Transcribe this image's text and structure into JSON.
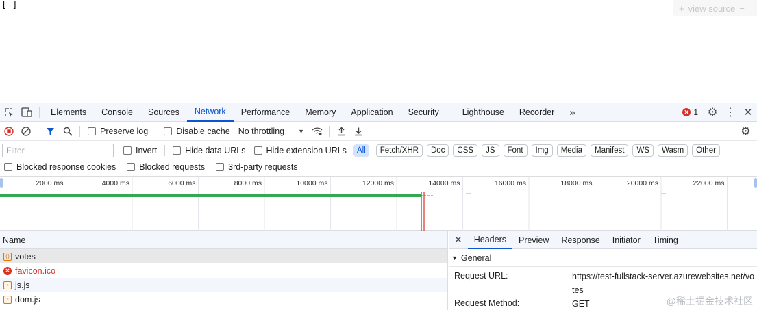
{
  "page": {
    "content": "[ ]",
    "view_source": "view source",
    "view_source_plus": "+",
    "view_source_minus": "−"
  },
  "devtools": {
    "tabs": [
      "Elements",
      "Console",
      "Sources",
      "Network",
      "Performance",
      "Memory",
      "Application",
      "Security",
      "Lighthouse",
      "Recorder"
    ],
    "more_tabs": "»",
    "error_count": "1",
    "toolbar": {
      "preserve_log": "Preserve log",
      "disable_cache": "Disable cache",
      "throttling": "No throttling",
      "throttling_arrow": "▼"
    },
    "filter": {
      "placeholder": "Filter",
      "invert": "Invert",
      "hide_data_urls": "Hide data URLs",
      "hide_extension_urls": "Hide extension URLs",
      "types": [
        "All",
        "Fetch/XHR",
        "Doc",
        "CSS",
        "JS",
        "Font",
        "Img",
        "Media",
        "Manifest",
        "WS",
        "Wasm",
        "Other"
      ]
    },
    "blocking": {
      "blocked_response_cookies": "Blocked response cookies",
      "blocked_requests": "Blocked requests",
      "third_party": "3rd-party requests"
    },
    "timeline_ticks": [
      "2000 ms",
      "4000 ms",
      "6000 ms",
      "8000 ms",
      "10000 ms",
      "12000 ms",
      "14000 ms",
      "16000 ms",
      "18000 ms",
      "20000 ms",
      "22000 ms"
    ],
    "list": {
      "header": "Name",
      "requests": [
        {
          "name": "votes",
          "kind": "fetch"
        },
        {
          "name": "favicon.ico",
          "kind": "error"
        },
        {
          "name": "js.js",
          "kind": "js"
        },
        {
          "name": "dom.js",
          "kind": "js"
        }
      ]
    },
    "details": {
      "close": "✕",
      "tabs": [
        "Headers",
        "Preview",
        "Response",
        "Initiator",
        "Timing"
      ],
      "section": "General",
      "section_arrow": "▼",
      "request_url_label": "Request URL:",
      "request_url_value": "https://test-fullstack-server.azurewebsites.net/votes",
      "request_method_label": "Request Method:",
      "request_method_value": "GET"
    },
    "watermark": "@稀土掘金技术社区"
  },
  "colors": {
    "accent": "#0b57d0",
    "error": "#d93025",
    "bar": "#34a853"
  }
}
